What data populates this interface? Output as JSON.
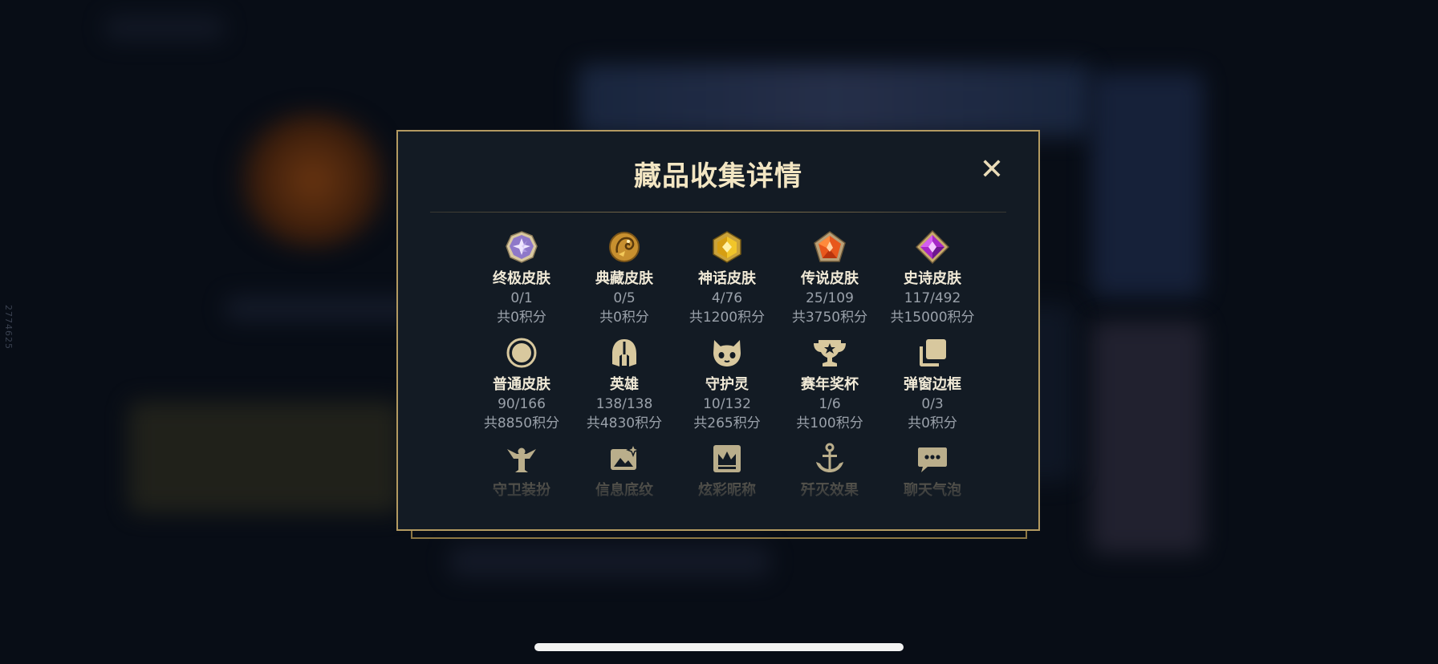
{
  "background": {
    "side_text": "2774625"
  },
  "modal": {
    "title": "藏品收集详情",
    "close_glyph": "✕",
    "rows": [
      {
        "items": [
          {
            "label": "终极皮肤",
            "count": "0/1",
            "points": "共0积分",
            "icon": "ultimate-gem-icon"
          },
          {
            "label": "典藏皮肤",
            "count": "0/5",
            "points": "共0积分",
            "icon": "dragon-emblem-icon"
          },
          {
            "label": "神话皮肤",
            "count": "4/76",
            "points": "共1200积分",
            "icon": "mythic-gem-icon"
          },
          {
            "label": "传说皮肤",
            "count": "25/109",
            "points": "共3750积分",
            "icon": "legendary-gem-icon"
          },
          {
            "label": "史诗皮肤",
            "count": "117/492",
            "points": "共15000积分",
            "icon": "epic-gem-icon"
          }
        ]
      },
      {
        "items": [
          {
            "label": "普通皮肤",
            "count": "90/166",
            "points": "共8850积分",
            "icon": "circle-icon"
          },
          {
            "label": "英雄",
            "count": "138/138",
            "points": "共4830积分",
            "icon": "helmet-icon"
          },
          {
            "label": "守护灵",
            "count": "10/132",
            "points": "共265积分",
            "icon": "guardian-face-icon"
          },
          {
            "label": "赛年奖杯",
            "count": "1/6",
            "points": "共100积分",
            "icon": "trophy-icon"
          },
          {
            "label": "弹窗边框",
            "count": "0/3",
            "points": "共0积分",
            "icon": "stacked-frames-icon"
          }
        ]
      },
      {
        "items": [
          {
            "label": "守卫装扮",
            "icon": "ward-icon"
          },
          {
            "label": "信息底纹",
            "icon": "image-sparkle-icon"
          },
          {
            "label": "炫彩昵称",
            "icon": "crown-card-icon"
          },
          {
            "label": "歼灭效果",
            "icon": "anchor-icon"
          },
          {
            "label": "聊天气泡",
            "icon": "chat-bubble-icon"
          }
        ]
      }
    ]
  },
  "colors": {
    "frame_gold": "#b39a61",
    "title": "#f3e6c3",
    "panel": "#131b24"
  }
}
